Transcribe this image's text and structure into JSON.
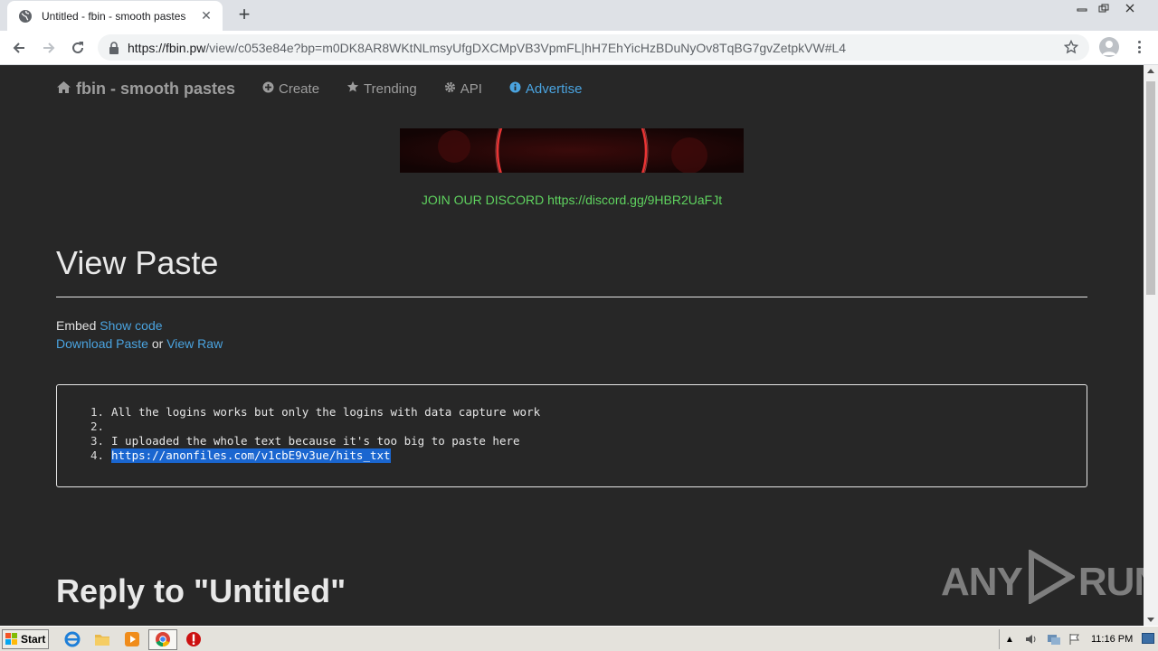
{
  "browser": {
    "tab_title": "Untitled - fbin - smooth pastes",
    "url_host": "https://fbin.pw",
    "url_path": "/view/c053e84e?bp=m0DK8AR8WKtNLmsyUfgDXCMpVB3VpmFL|hH7EhYicHzBDuNyOv8TqBG7gvZetpkVW#L4"
  },
  "site_nav": {
    "brand": "fbin - smooth pastes",
    "items": [
      {
        "label": "Create",
        "icon": "plus-circle-icon"
      },
      {
        "label": "Trending",
        "icon": "star-icon"
      },
      {
        "label": "API",
        "icon": "gear-icon"
      },
      {
        "label": "Advertise",
        "icon": "info-icon"
      }
    ]
  },
  "discord_text": "JOIN OUR DISCORD https://discord.gg/9HBR2UaFJt",
  "view": {
    "heading": "View Paste",
    "embed_label": "Embed",
    "show_code": "Show code",
    "download": "Download Paste",
    "or": "or",
    "view_raw": "View Raw"
  },
  "paste_lines": [
    {
      "num": "1.",
      "text": "All the logins works but only the logins with data capture work"
    },
    {
      "num": "2.",
      "text": ""
    },
    {
      "num": "3.",
      "text": "I uploaded the whole text because it's too big to paste here"
    },
    {
      "num": "4.",
      "text": "https://anonfiles.com/v1cbE9v3ue/hits_txt"
    }
  ],
  "reply_heading": "Reply to \"Untitled\"",
  "watermark": {
    "left": "ANY",
    "right": "RUN"
  },
  "taskbar": {
    "start_label": "Start",
    "clock": "11:16 PM"
  },
  "colors": {
    "page_bg": "#272727",
    "link": "#4aa3df",
    "discord_green": "#5fd35f",
    "selection": "#1a66d0"
  }
}
